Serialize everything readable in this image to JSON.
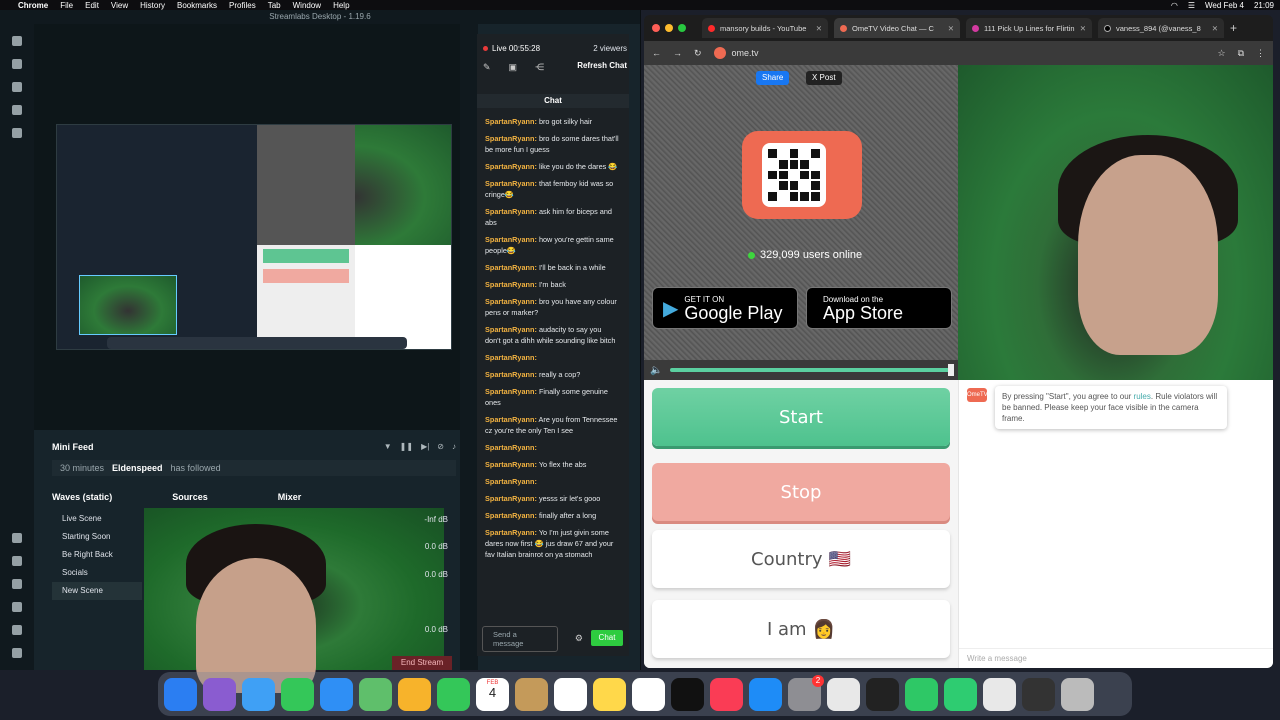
{
  "menubar": {
    "app": "Chrome",
    "items": [
      "File",
      "Edit",
      "View",
      "History",
      "Bookmarks",
      "Profiles",
      "Tab",
      "Window",
      "Help"
    ],
    "date": "Wed Feb 4",
    "time": "21:09"
  },
  "streamlabs": {
    "title": "Streamlabs Desktop - 1.19.6",
    "live_time": "Live 00:55:28",
    "viewers": "2 viewers",
    "refresh": "Refresh Chat",
    "chat_title": "Chat",
    "messages": [
      {
        "user": "SpartanRyann:",
        "text": "bro got silky hair"
      },
      {
        "user": "SpartanRyann:",
        "text": "bro do some dares that'll be more fun I guess"
      },
      {
        "user": "SpartanRyann:",
        "text": "like you do the dares 😂"
      },
      {
        "user": "SpartanRyann:",
        "text": "that femboy kid was so cringe😂"
      },
      {
        "user": "SpartanRyann:",
        "text": "ask him for biceps and abs"
      },
      {
        "user": "SpartanRyann:",
        "text": "how you're gettin same people😂"
      },
      {
        "user": "SpartanRyann:",
        "text": "I'll be back in a while"
      },
      {
        "user": "SpartanRyann:",
        "text": "I'm back"
      },
      {
        "user": "SpartanRyann:",
        "text": "bro you have any colour pens or marker?"
      },
      {
        "user": "SpartanRyann:",
        "text": "audacity to say you don't got a dihh while sounding like bitch"
      },
      {
        "user": "SpartanRyann:",
        "text": ""
      },
      {
        "user": "SpartanRyann:",
        "text": "really a cop?"
      },
      {
        "user": "SpartanRyann:",
        "text": "Finally some genuine ones"
      },
      {
        "user": "SpartanRyann:",
        "text": "Are you from Tennessee cz you're the only Ten I see"
      },
      {
        "user": "SpartanRyann:",
        "text": ""
      },
      {
        "user": "SpartanRyann:",
        "text": "Yo flex the abs"
      },
      {
        "user": "SpartanRyann:",
        "text": ""
      },
      {
        "user": "SpartanRyann:",
        "text": "yesss sir let's gooo"
      },
      {
        "user": "SpartanRyann:",
        "text": "finally after a long"
      },
      {
        "user": "SpartanRyann:",
        "text": "Yo I'm just givin some dares now first 😂 jus draw 67 and your fav Italian brainrot on ya stomach"
      }
    ],
    "send_placeholder": "Send a message",
    "chat_button": "Chat",
    "minifeed": {
      "title": "Mini Feed",
      "ago": "30 minutes",
      "user": "Eldenspeed",
      "action": "has followed"
    },
    "scenes_title": "Waves (static)",
    "sources_title": "Sources",
    "mixer_title": "Mixer",
    "scenes": [
      "Live Scene",
      "Starting Soon",
      "Be Right Back",
      "Socials",
      "New Scene"
    ],
    "mixer": [
      "-Inf dB",
      "0.0 dB",
      "0.0 dB",
      "0.0 dB"
    ],
    "end_stream": "End Stream"
  },
  "chrome": {
    "tabs": [
      {
        "title": "mansory builds - YouTube",
        "color": "#ff2a2a"
      },
      {
        "title": "OmeTV Video Chat — C",
        "color": "#ee6a52"
      },
      {
        "title": "111 Pick Up Lines for Flirtin",
        "color": "#d33aa0"
      },
      {
        "title": "vaness_894 (@vaness_8",
        "color": "#000000"
      }
    ],
    "url": "ome.tv",
    "share": "Share",
    "post": "X Post",
    "online": "329,099 users online",
    "gp_small": "GET IT ON",
    "gp_big": "Google Play",
    "as_small": "Download on the",
    "as_big": "App Store",
    "start": "Start",
    "stop": "Stop",
    "country": "Country",
    "iam": "I am",
    "notice_pre": "By pressing \"Start\", you agree to our ",
    "notice_link": "rules",
    "notice_post": ". Rule violators will be banned. Please keep your face visible in the camera frame.",
    "message_placeholder": "Write a message",
    "logo": "OmeTV"
  },
  "dock": {
    "calendar_month": "FEB",
    "calendar_day": "4",
    "badge": "2"
  },
  "colors": {
    "start": "#4ec28e",
    "stop": "#f0a9a0",
    "ome": "#ee6a52",
    "chat_user": "#f3b341",
    "chat_send": "#2ecc40"
  }
}
